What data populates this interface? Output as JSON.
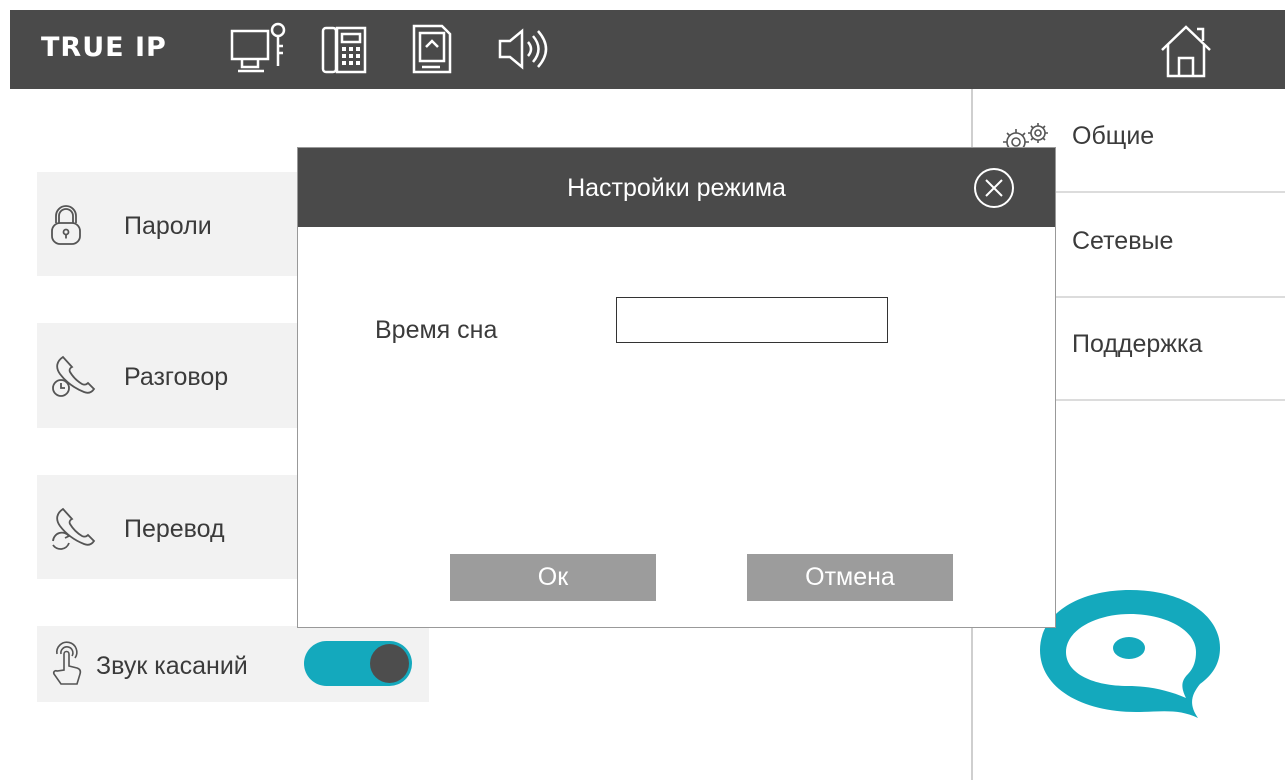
{
  "header": {
    "brand": "TRUE IP",
    "icons": [
      "monitor-key-icon",
      "intercom-handset-icon",
      "sd-card-icon",
      "speaker-icon",
      "home-icon"
    ]
  },
  "left_menu": {
    "items": [
      {
        "label": "Пароли",
        "icon": "lock-icon"
      },
      {
        "label": "Разговор",
        "icon": "call-timer-icon"
      },
      {
        "label": "Перевод",
        "icon": "call-transfer-icon"
      }
    ],
    "touch_sound": {
      "label": "Звук касаний",
      "icon": "touch-finger-icon",
      "enabled": true
    }
  },
  "right_menu": {
    "items": [
      {
        "label": "Общие",
        "icon": "gear-icon"
      },
      {
        "label": "Сетевые"
      },
      {
        "label": "Поддержка"
      }
    ]
  },
  "modal": {
    "title": "Настройки режима",
    "field_label": "Время сна",
    "field_value": "",
    "ok_label": "Ок",
    "cancel_label": "Отмена"
  },
  "colors": {
    "bar": "#4a4a4a",
    "accent": "#14a9bd",
    "card": "#f2f2f2",
    "button": "#9c9c9c"
  }
}
